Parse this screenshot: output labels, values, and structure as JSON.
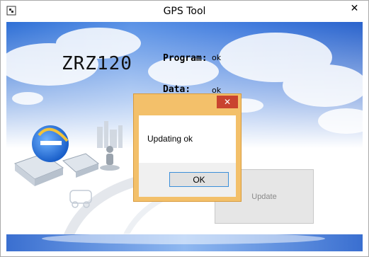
{
  "window": {
    "title": "GPS Tool",
    "close_glyph": "✕",
    "icon": "gps-app-icon"
  },
  "main": {
    "model": "ZRZ120",
    "program_label": "Program:",
    "program_value": "ok",
    "data_label": "Data:",
    "data_value": "ok",
    "update_button": "Update"
  },
  "dialog": {
    "message": "Updating ok",
    "ok_button": "OK",
    "close_glyph": "✕"
  },
  "colors": {
    "sky": "#3f7fe0",
    "dialog_frame": "#f3c06a",
    "dialog_close": "#c9432f",
    "ok_border": "#3b8fd9"
  }
}
